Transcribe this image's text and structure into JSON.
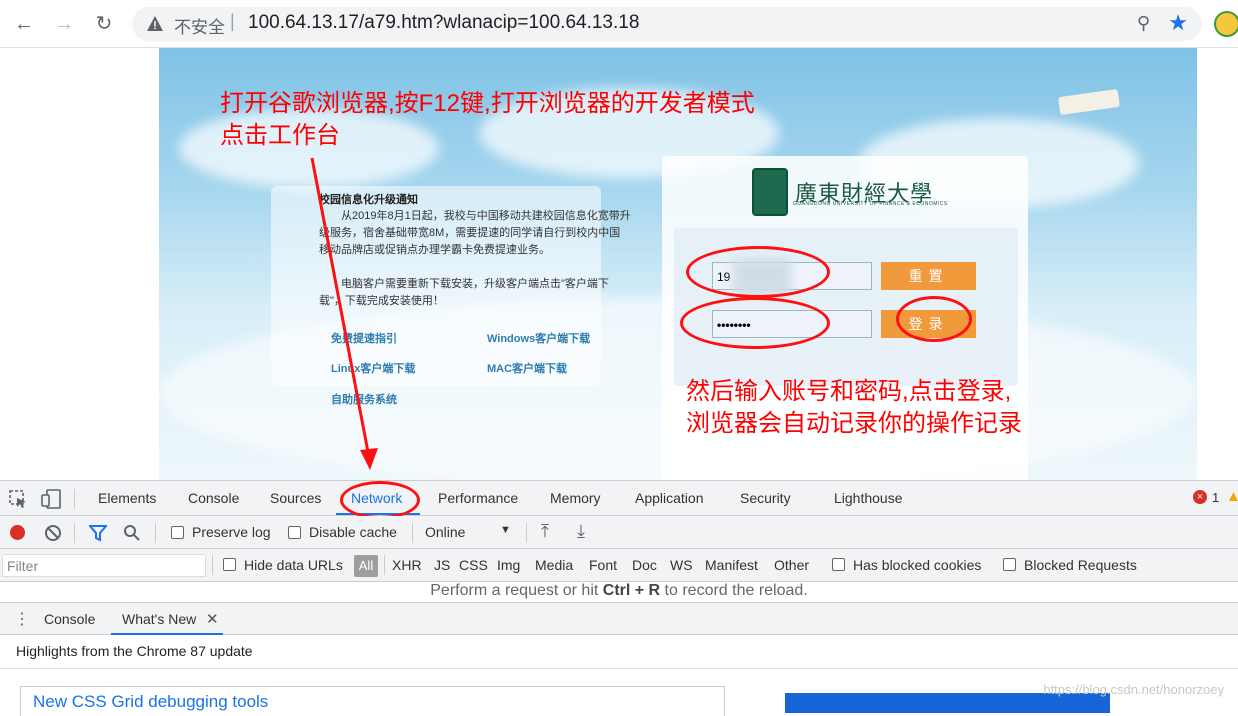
{
  "browser": {
    "insecure_label": "不安全",
    "url": "100.64.13.17/a79.htm?wlanacip=100.64.13.18"
  },
  "portal": {
    "notice_title": "校园信息化升级通知",
    "notice_p1": "从2019年8月1日起，我校与中国移动共建校园信息化宽带升级服务，宿舍基础带宽8M，需要提速的同学请自行到校内中国移动品牌店或促销点办理学霸卡免费提速业务。",
    "notice_p2": "电脑客户需要重新下载安装，升级客户端点击\"客户端下载\"，下载完成安装使用！",
    "links": [
      "免费提速指引",
      "Windows客户端下载",
      "Linux客户端下载",
      "MAC客户端下载",
      "自助服务系统"
    ],
    "university_name": "廣東財經大學",
    "university_sub": "GUANGDONG UNIVERSITY OF FINANCE & ECONOMICS",
    "username_value": "19",
    "password_value": "••••••••",
    "reset_label": "重置",
    "login_label": "登录"
  },
  "annotations": {
    "top_line1": "打开谷歌浏览器,按F12键,打开浏览器的开发者模式",
    "top_line2": "点击工作台",
    "right_line1": "然后输入账号和密码,点击登录,",
    "right_line2": "浏览器会自动记录你的操作记录"
  },
  "devtools": {
    "tabs": [
      "Elements",
      "Console",
      "Sources",
      "Network",
      "Performance",
      "Memory",
      "Application",
      "Security",
      "Lighthouse"
    ],
    "active_tab": "Network",
    "error_count": "1",
    "preserve_log": "Preserve log",
    "disable_cache": "Disable cache",
    "throttle": "Online",
    "filter_placeholder": "Filter",
    "hide_data_urls": "Hide data URLs",
    "type_filters": [
      "All",
      "XHR",
      "JS",
      "CSS",
      "Img",
      "Media",
      "Font",
      "Doc",
      "WS",
      "Manifest",
      "Other"
    ],
    "has_blocked_cookies": "Has blocked cookies",
    "blocked_requests": "Blocked Requests",
    "record_msg_prefix": "Perform a request or hit ",
    "record_msg_keys": "Ctrl + R",
    "record_msg_suffix": " to record the reload.",
    "drawer_tabs": [
      "Console",
      "What's New"
    ],
    "highlights": "Highlights from the Chrome 87 update",
    "card_title": "New CSS Grid debugging tools",
    "watermark": "https://blog.csdn.net/honorzoey"
  },
  "colors": {
    "annotation_red": "#ff0000",
    "accent_blue": "#1a73e8",
    "button_orange": "#f19a3b"
  }
}
